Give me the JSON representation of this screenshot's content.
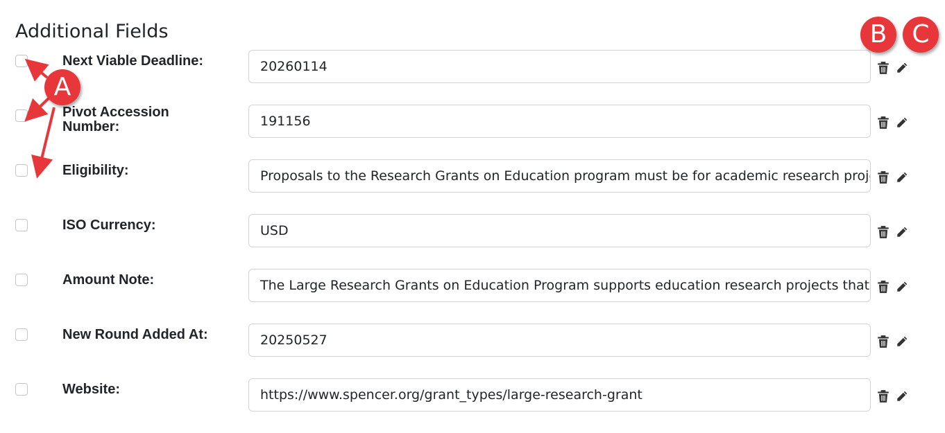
{
  "section": {
    "title": "Additional Fields"
  },
  "fields": [
    {
      "label": "Next Viable Deadline:",
      "value": "20260114"
    },
    {
      "label": "Pivot Accession Number:",
      "value": "191156"
    },
    {
      "label": "Eligibility:",
      "value": "Proposals to the Research Grants on Education program must be for academic research projects"
    },
    {
      "label": "ISO Currency:",
      "value": "USD"
    },
    {
      "label": "Amount Note:",
      "value": "The Large Research Grants on Education Program supports education research projects that will"
    },
    {
      "label": "New Round Added At:",
      "value": "20250527"
    },
    {
      "label": "Website:",
      "value": "https://www.spencer.org/grant_types/large-research-grant"
    }
  ],
  "annotations": {
    "a": "A",
    "b": "B",
    "c": "C"
  },
  "colors": {
    "annotation_red": "#e8373b",
    "text": "#212529",
    "border": "#ced4da"
  },
  "icons": {
    "delete": "trash-icon",
    "edit": "pencil-icon"
  }
}
